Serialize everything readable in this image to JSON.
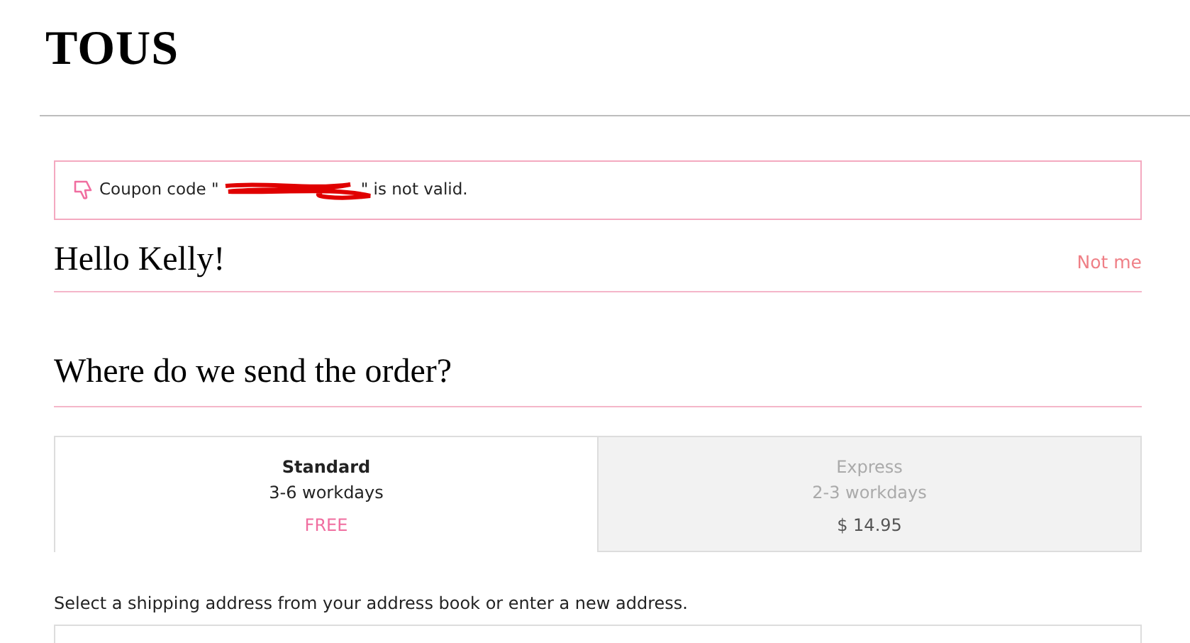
{
  "logo": "TOUS",
  "alert": {
    "prefix": "Coupon code \"",
    "suffix": "\" is not valid."
  },
  "greeting": "Hello Kelly!",
  "not_me_link": "Not me",
  "section_title": "Where do we send the order?",
  "shipping_options": [
    {
      "name": "Standard",
      "time": "3-6 workdays",
      "price": "FREE",
      "selected": true
    },
    {
      "name": "Express",
      "time": "2-3 workdays",
      "price": "$ 14.95",
      "selected": false
    }
  ],
  "instructions": "Select a shipping address from your address book or enter a new address."
}
